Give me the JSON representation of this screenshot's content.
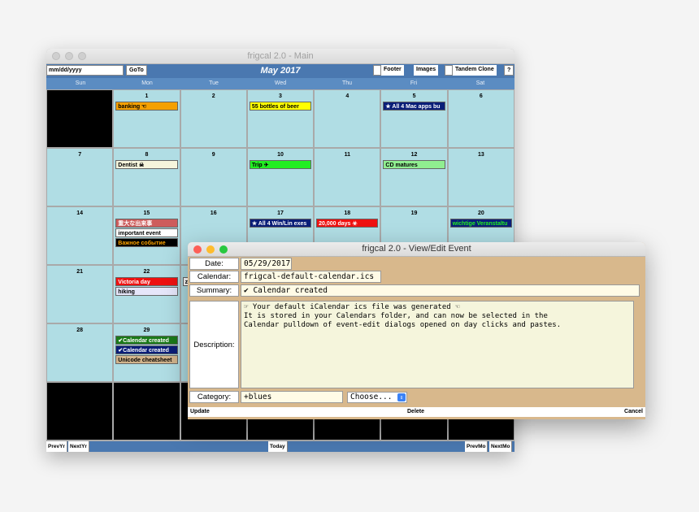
{
  "main_window": {
    "title": "frigcal 2.0 - Main",
    "toolbar": {
      "date_placeholder": "mm/dd/yyyy",
      "goto_label": "GoTo",
      "month_title": "May 2017",
      "footer_label": "Footer",
      "images_label": "Images",
      "tandem_clone_label": "Tandem  Clone",
      "help_label": "?"
    },
    "day_names": [
      "Sun",
      "Mon",
      "Tue",
      "Wed",
      "Thu",
      "Fri",
      "Sat"
    ],
    "weeks": [
      [
        {
          "day": "",
          "black": true,
          "events": []
        },
        {
          "day": "1",
          "events": [
            {
              "text": "banking ☜",
              "bg": "#f5a000",
              "fg": "#000000"
            }
          ]
        },
        {
          "day": "2",
          "events": []
        },
        {
          "day": "3",
          "events": [
            {
              "text": "55 bottles of beer",
              "bg": "#ffff00",
              "fg": "#000000"
            }
          ]
        },
        {
          "day": "4",
          "events": []
        },
        {
          "day": "5",
          "events": [
            {
              "text": "★ All 4 Mac apps bu",
              "bg": "#0a1e78",
              "fg": "#ffffff"
            }
          ]
        },
        {
          "day": "6",
          "events": []
        }
      ],
      [
        {
          "day": "7",
          "events": []
        },
        {
          "day": "8",
          "events": [
            {
              "text": "Dentist ☠",
              "bg": "#f5f5dc",
              "fg": "#000000"
            }
          ]
        },
        {
          "day": "9",
          "events": []
        },
        {
          "day": "10",
          "events": [
            {
              "text": "Trip ✈",
              "bg": "#22ee22",
              "fg": "#000000"
            }
          ]
        },
        {
          "day": "11",
          "events": []
        },
        {
          "day": "12",
          "events": [
            {
              "text": "CD matures",
              "bg": "#90ee90",
              "fg": "#000000"
            }
          ]
        },
        {
          "day": "13",
          "events": []
        }
      ],
      [
        {
          "day": "14",
          "events": []
        },
        {
          "day": "15",
          "events": [
            {
              "text": "重大な出来事",
              "bg": "#cd5c5c",
              "fg": "#ffffff"
            },
            {
              "text": "important event",
              "bg": "#ffffff",
              "fg": "#000000"
            },
            {
              "text": "Важное событие",
              "bg": "#000000",
              "fg": "#ffa500"
            }
          ]
        },
        {
          "day": "16",
          "events": []
        },
        {
          "day": "17",
          "events": [
            {
              "text": "★ All 4 Win/Lin exes",
              "bg": "#0a1e78",
              "fg": "#ffffff"
            }
          ]
        },
        {
          "day": "18",
          "events": [
            {
              "text": "20,000 days ☣",
              "bg": "#ee1111",
              "fg": "#ffffff"
            }
          ]
        },
        {
          "day": "19",
          "events": []
        },
        {
          "day": "20",
          "events": [
            {
              "text": "wichtige Veranstaltu",
              "bg": "#0a1e78",
              "fg": "#22ee22"
            }
          ]
        }
      ],
      [
        {
          "day": "21",
          "events": []
        },
        {
          "day": "22",
          "events": [
            {
              "text": "Victoria day",
              "bg": "#ee1111",
              "fg": "#ffffff"
            },
            {
              "text": "hiking",
              "bg": "#e6e6fa",
              "fg": "#000000"
            }
          ]
        },
        {
          "day": "",
          "events": [
            {
              "text": "z",
              "bg": "#ffffff",
              "fg": "#000000"
            }
          ]
        },
        {
          "day": "",
          "events": []
        },
        {
          "day": "",
          "events": []
        },
        {
          "day": "",
          "events": []
        },
        {
          "day": "",
          "events": []
        }
      ],
      [
        {
          "day": "28",
          "events": []
        },
        {
          "day": "29",
          "events": [
            {
              "text": "✔Calendar created",
              "bg": "#1a7a1a",
              "fg": "#ffffff"
            },
            {
              "text": "✔Calendar created",
              "bg": "#0a1e78",
              "fg": "#ffffff"
            },
            {
              "text": "Unicode cheatsheet",
              "bg": "#d2b48c",
              "fg": "#000000"
            }
          ]
        },
        {
          "day": "",
          "events": []
        },
        {
          "day": "",
          "events": []
        },
        {
          "day": "",
          "events": []
        },
        {
          "day": "",
          "events": []
        },
        {
          "day": "",
          "events": []
        }
      ],
      [
        {
          "day": "",
          "black": true,
          "events": []
        },
        {
          "day": "",
          "black": true,
          "events": []
        },
        {
          "day": "",
          "black": true,
          "events": []
        },
        {
          "day": "",
          "black": true,
          "events": []
        },
        {
          "day": "",
          "black": true,
          "events": []
        },
        {
          "day": "",
          "black": true,
          "events": []
        },
        {
          "day": "",
          "black": true,
          "events": []
        }
      ]
    ],
    "bottom_bar": {
      "prev_yr": "PrevYr",
      "next_yr": "NextYr",
      "today": "Today",
      "prev_mo": "PrevMo",
      "next_mo": "NextMo"
    }
  },
  "event_dialog": {
    "title": "frigcal 2.0 - View/Edit Event",
    "date_label": "Date:",
    "date_value": "05/29/2017",
    "calendar_label": "Calendar:",
    "calendar_value": "frigcal-default-calendar.ics",
    "summary_label": "Summary:",
    "summary_value": "✔ Calendar created",
    "description_label": "Description:",
    "description_lines": [
      "☞ Your default iCalendar ics file was generated ☜",
      "It is stored in your Calendars folder, and can now be selected in the",
      "Calendar pulldown of event-edit dialogs opened on day clicks and pastes."
    ],
    "category_label": "Category:",
    "category_value": "+blues",
    "choose_label": "Choose...",
    "update_label": "Update",
    "delete_label": "Delete",
    "cancel_label": "Cancel"
  }
}
